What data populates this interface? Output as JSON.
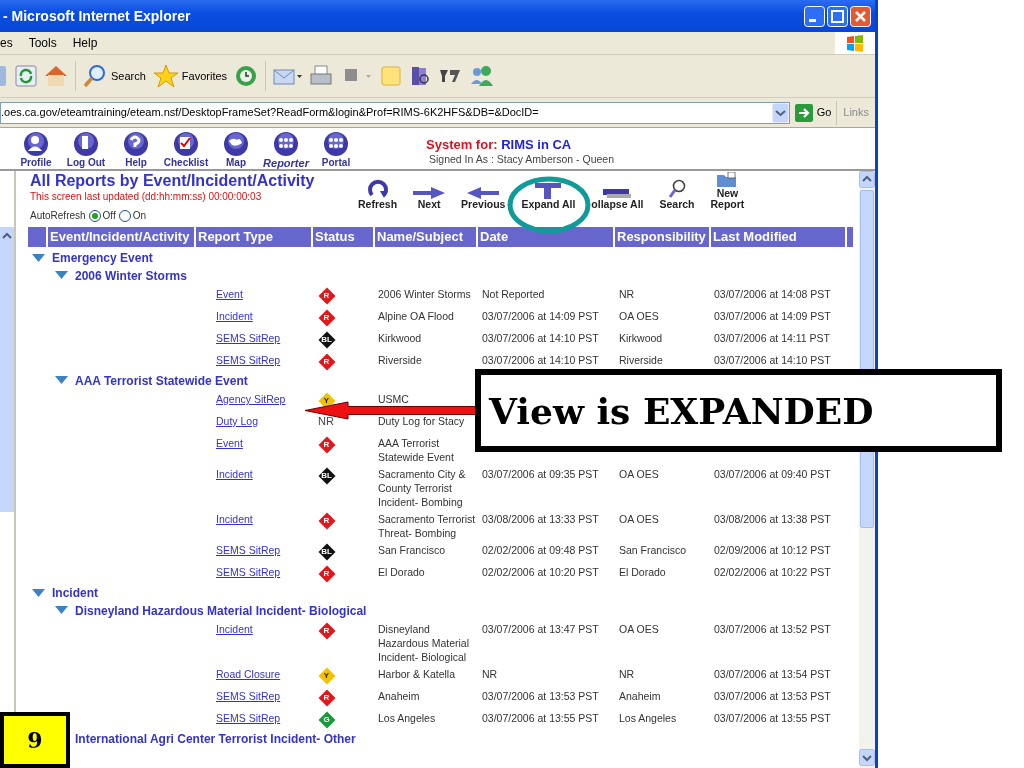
{
  "window": {
    "title": "- Microsoft Internet Explorer"
  },
  "menu": [
    "es",
    "Tools",
    "Help"
  ],
  "toolbar": {
    "search_label": "Search",
    "favorites_label": "Favorites"
  },
  "address": {
    "url": ".oes.ca.gov/eteamtraining/eteam.nsf/DesktopFrameSet?ReadForm&login&Prof=RIMS-6K2HFS&DB=&DocID=",
    "go": "Go",
    "links": "Links"
  },
  "nav": [
    {
      "label": "Profile",
      "kind": "profile",
      "emphasized": false
    },
    {
      "label": "Log Out",
      "kind": "logout",
      "emphasized": false
    },
    {
      "label": "Help",
      "kind": "help",
      "emphasized": false
    },
    {
      "label": "Checklist",
      "kind": "checklist",
      "emphasized": false
    },
    {
      "label": "Map",
      "kind": "map",
      "emphasized": false
    },
    {
      "label": "Reporter",
      "kind": "reporter",
      "emphasized": true
    },
    {
      "label": "Portal",
      "kind": "portal",
      "emphasized": false
    }
  ],
  "system": {
    "prefix": "System for:",
    "name": "RIMS in CA",
    "signed_in": "Signed In As : Stacy Amberson - Queen"
  },
  "report": {
    "title": "All Reports by Event/Incident/Activity",
    "updated": "This screen last updated (dd:hh:mm:ss) 00:00:00:03",
    "auto_refresh": {
      "label": "AutoRefresh",
      "options": [
        {
          "label": "Off",
          "selected": true
        },
        {
          "label": "On",
          "selected": false
        }
      ]
    }
  },
  "actions": [
    {
      "label": "Refresh",
      "kind": "refresh"
    },
    {
      "label": "Next",
      "kind": "next"
    },
    {
      "label": "Previous",
      "kind": "previous"
    },
    {
      "label": "Expand All",
      "kind": "expand"
    },
    {
      "label": "ollapse All",
      "kind": "collapse"
    },
    {
      "label": "Search",
      "kind": "search"
    },
    {
      "label": "New Report",
      "kind": "new"
    }
  ],
  "table": {
    "columns": [
      "Event/Incident/Activity",
      "Report Type",
      "Status",
      "Name/Subject",
      "Date",
      "Responsibility",
      "Last Modified"
    ],
    "groups": [
      {
        "label": "Emergency Event",
        "expanded": true,
        "children": [
          {
            "label": "2006 Winter Storms",
            "expanded": true,
            "reports": [
              {
                "type": "Event",
                "status": {
                  "kind": "diamond",
                  "label": "R",
                  "color": "#e3161c"
                },
                "name": "2006 Winter Storms",
                "date": "Not Reported",
                "responsibility": "NR",
                "modified": "03/07/2006 at 14:08 PST"
              },
              {
                "type": "Incident",
                "status": {
                  "kind": "diamond",
                  "label": "R",
                  "color": "#e3161c"
                },
                "name": "Alpine OA Flood",
                "date": "03/07/2006 at 14:09 PST",
                "responsibility": "OA OES",
                "modified": "03/07/2006 at 14:09 PST"
              },
              {
                "type": "SEMS SitRep",
                "status": {
                  "kind": "diamond",
                  "label": "BL",
                  "color": "#111111"
                },
                "name": "Kirkwood",
                "date": "03/07/2006 at 14:10 PST",
                "responsibility": "Kirkwood",
                "modified": "03/07/2006 at 14:11 PST"
              },
              {
                "type": "SEMS SitRep",
                "status": {
                  "kind": "diamond",
                  "label": "R",
                  "color": "#e3161c"
                },
                "name": "Riverside",
                "date": "03/07/2006 at 14:10 PST",
                "responsibility": "Riverside",
                "modified": "03/07/2006 at 14:10 PST"
              }
            ]
          },
          {
            "label": "AAA Terrorist Statewide Event",
            "expanded": true,
            "reports": [
              {
                "type": "Agency SitRep",
                "status": {
                  "kind": "diamond",
                  "label": "Y",
                  "color": "#f2c200"
                },
                "name": "USMC"
              },
              {
                "type": "Duty Log",
                "status": {
                  "kind": "text",
                  "label": "NR"
                },
                "name": "Duty Log for Stacy"
              },
              {
                "type": "Event",
                "status": {
                  "kind": "diamond",
                  "label": "R",
                  "color": "#e3161c"
                },
                "name": "AAA Terrorist Statewide Event"
              },
              {
                "type": "Incident",
                "status": {
                  "kind": "diamond",
                  "label": "BL",
                  "color": "#111111"
                },
                "name": "Sacramento City & County Terrorist Incident- Bombing",
                "date": "03/07/2006 at 09:35 PST",
                "responsibility": "OA OES",
                "modified": "03/07/2006 at 09:40 PST"
              },
              {
                "type": "Incident",
                "status": {
                  "kind": "diamond",
                  "label": "R",
                  "color": "#e3161c"
                },
                "name": "Sacramento Terrorist Threat- Bombing",
                "date": "03/08/2006 at 13:33 PST",
                "responsibility": "OA OES",
                "modified": "03/08/2006 at 13:38 PST"
              },
              {
                "type": "SEMS SitRep",
                "status": {
                  "kind": "diamond",
                  "label": "BL",
                  "color": "#111111"
                },
                "name": "San Francisco",
                "date": "02/02/2006 at 09:48 PST",
                "responsibility": "San Francisco",
                "modified": "02/09/2006 at 10:12 PST"
              },
              {
                "type": "SEMS SitRep",
                "status": {
                  "kind": "diamond",
                  "label": "R",
                  "color": "#e3161c"
                },
                "name": "El Dorado",
                "date": "02/02/2006 at 10:20 PST",
                "responsibility": "El Dorado",
                "modified": "02/02/2006 at 10:22 PST"
              }
            ]
          }
        ]
      },
      {
        "label": "Incident",
        "expanded": true,
        "children": [
          {
            "label": "Disneyland Hazardous Material Incident- Biological",
            "expanded": true,
            "reports": [
              {
                "type": "Incident",
                "status": {
                  "kind": "diamond",
                  "label": "R",
                  "color": "#e3161c"
                },
                "name": "Disneyland Hazardous Material Incident- Biological",
                "date": "03/07/2006 at 13:47 PST",
                "responsibility": "OA OES",
                "modified": "03/07/2006 at 13:52 PST"
              },
              {
                "type": "Road Closure",
                "status": {
                  "kind": "diamond",
                  "label": "Y",
                  "color": "#f2c200"
                },
                "name": "Harbor & Katella",
                "date": "NR",
                "responsibility": "NR",
                "modified": "03/07/2006 at 13:54 PST"
              },
              {
                "type": "SEMS SitRep",
                "status": {
                  "kind": "diamond",
                  "label": "R",
                  "color": "#e3161c"
                },
                "name": "Anaheim",
                "date": "03/07/2006 at 13:53 PST",
                "responsibility": "Anaheim",
                "modified": "03/07/2006 at 13:53 PST"
              },
              {
                "type": "SEMS SitRep",
                "status": {
                  "kind": "diamond",
                  "label": "G",
                  "color": "#1a9a3a"
                },
                "name": "Los Angeles",
                "date": "03/07/2006 at 13:55 PST",
                "responsibility": "Los Angeles",
                "modified": "03/07/2006 at 13:55 PST"
              }
            ]
          },
          {
            "label": "International Agri Center Terrorist Incident- Other"
          }
        ]
      }
    ]
  },
  "callout": {
    "text": "View is EXPANDED"
  },
  "step_badge": "9"
}
